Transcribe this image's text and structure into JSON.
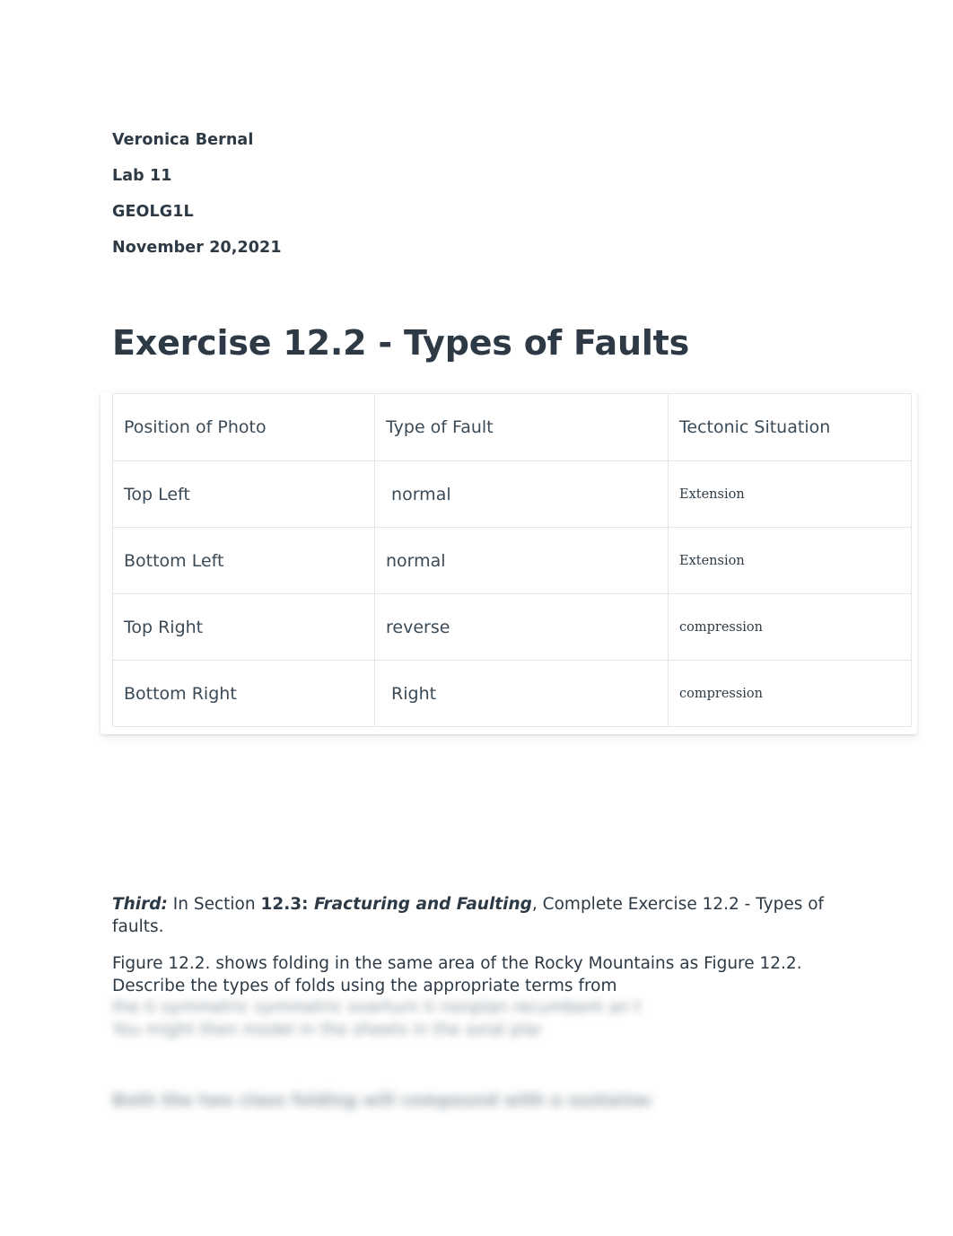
{
  "document": {
    "header_lines": [
      "Veronica Bernal",
      "Lab 11",
      "GEOLG1L",
      "November 20,2021"
    ],
    "title": "Exercise 12.2 - Types of Faults"
  },
  "table": {
    "columns": [
      "Position of Photo",
      "Type of Fault",
      "Tectonic Situation"
    ],
    "rows": [
      {
        "position": "Top Left",
        "type_of_fault": " normal",
        "tectonic_situation": "Extension"
      },
      {
        "position": "Bottom Left",
        "type_of_fault": "normal",
        "tectonic_situation": "Extension"
      },
      {
        "position": "Top Right",
        "type_of_fault": "reverse",
        "tectonic_situation": "compression"
      },
      {
        "position": "Bottom Right",
        "type_of_fault": " Right",
        "tectonic_situation": "compression"
      }
    ]
  },
  "prose": {
    "third_label": "Third:",
    "third_text_1": " In Section ",
    "third_section_ref": "12.3: ",
    "third_section_name": "Fracturing and Faulting",
    "third_text_2": ", Complete Exercise 12.2 - Types of faults.",
    "figure_paragraph": "Figure 12.2. shows folding in the same area of the Rocky Mountains as Figure 12.2. Describe the types of folds using the appropriate terms from"
  },
  "locked_preview": {
    "line_1": "the ti symmetric symmetric overturn ti nonplan recumbent an t",
    "line_2": "You might then model in the sheets in the axial plane.",
    "line_3": "Both the two class folding will compound with a sustained form"
  }
}
